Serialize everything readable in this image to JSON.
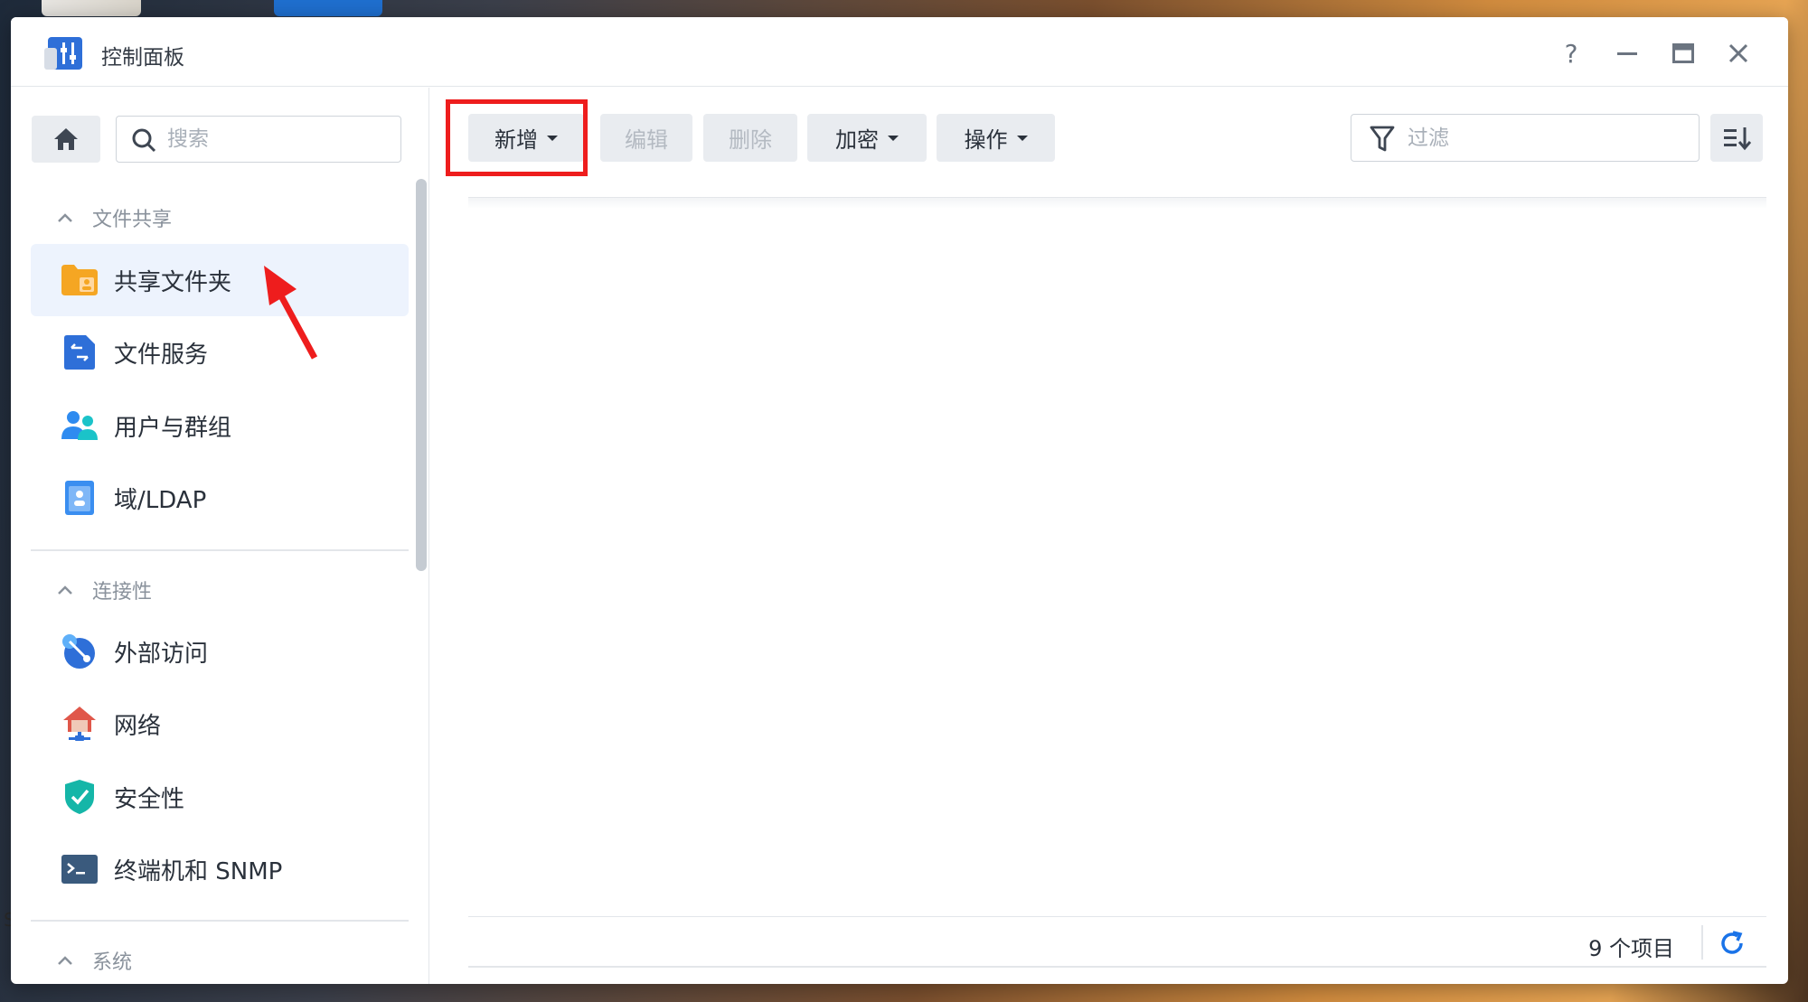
{
  "window": {
    "title": "控制面板",
    "controls": {
      "help": "?",
      "minimize": "minimize-icon",
      "maximize": "maximize-icon",
      "close": "close-icon"
    }
  },
  "sidebar": {
    "search_placeholder": "搜索",
    "sections": [
      {
        "title": "文件共享",
        "items": [
          {
            "label": "共享文件夹",
            "icon": "shared-folder-icon",
            "active": true
          },
          {
            "label": "文件服务",
            "icon": "file-services-icon"
          },
          {
            "label": "用户与群组",
            "icon": "users-groups-icon"
          },
          {
            "label": "域/LDAP",
            "icon": "domain-ldap-icon"
          }
        ]
      },
      {
        "title": "连接性",
        "items": [
          {
            "label": "外部访问",
            "icon": "external-access-icon"
          },
          {
            "label": "网络",
            "icon": "network-icon"
          },
          {
            "label": "安全性",
            "icon": "security-icon"
          },
          {
            "label": "终端机和 SNMP",
            "icon": "terminal-snmp-icon"
          }
        ]
      },
      {
        "title": "系统",
        "items": []
      }
    ]
  },
  "toolbar": {
    "create_label": "新增",
    "edit_label": "编辑",
    "delete_label": "删除",
    "encrypt_label": "加密",
    "action_label": "操作",
    "filter_placeholder": "过滤"
  },
  "footer": {
    "item_count": "9 个项目"
  },
  "colors": {
    "accent": "#1a73e8",
    "highlight": "#ee1d1d",
    "active_bg": "#edf3fd"
  }
}
